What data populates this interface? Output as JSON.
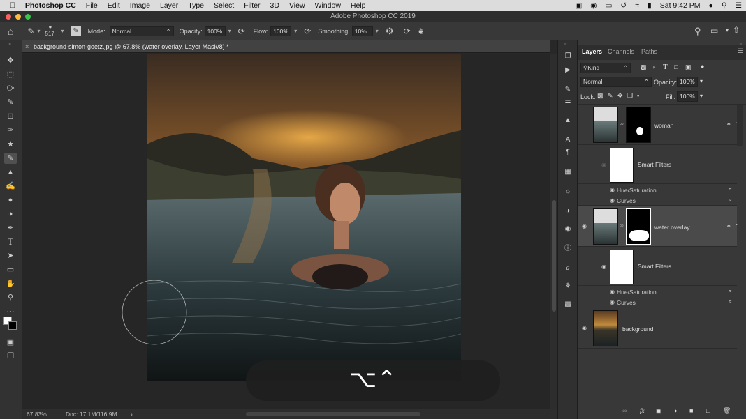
{
  "menubar": {
    "app": "Photoshop CC",
    "items": [
      "File",
      "Edit",
      "Image",
      "Layer",
      "Type",
      "Select",
      "Filter",
      "3D",
      "View",
      "Window",
      "Help"
    ],
    "clock": "Sat 9:42 PM"
  },
  "window_title": "Adobe Photoshop CC 2019",
  "options": {
    "brush_size": "517",
    "mode_label": "Mode:",
    "mode_value": "Normal",
    "opacity_label": "Opacity:",
    "opacity_value": "100%",
    "flow_label": "Flow:",
    "flow_value": "100%",
    "smoothing_label": "Smoothing:",
    "smoothing_value": "10%"
  },
  "document": {
    "tab_title": "background-simon-goetz.jpg @ 67.8% (water overlay, Layer Mask/8) *",
    "zoom": "67.83%",
    "doc_size": "Doc: 17.1M/116.9M",
    "shortcut_overlay": "⌥⌃"
  },
  "panel": {
    "tabs": [
      "Layers",
      "Channels",
      "Paths"
    ],
    "filter_kind": "Kind",
    "blend_mode": "Normal",
    "opacity_label": "Opacity:",
    "opacity_value": "100%",
    "lock_label": "Lock:",
    "fill_label": "Fill:",
    "fill_value": "100%",
    "layers": {
      "woman": "woman",
      "smart_filters_1": "Smart Filters",
      "hue_sat_1": "Hue/Saturation",
      "curves_1": "Curves",
      "water_overlay": "water overlay",
      "smart_filters_2": "Smart Filters",
      "hue_sat_2": "Hue/Saturation",
      "curves_2": "Curves",
      "background": "background"
    }
  },
  "colors": {
    "panel_bg": "#383838",
    "selected_layer": "#4a4a4a",
    "canvas_bg": "#262626",
    "menubar_bg": "#dcdcdc"
  }
}
